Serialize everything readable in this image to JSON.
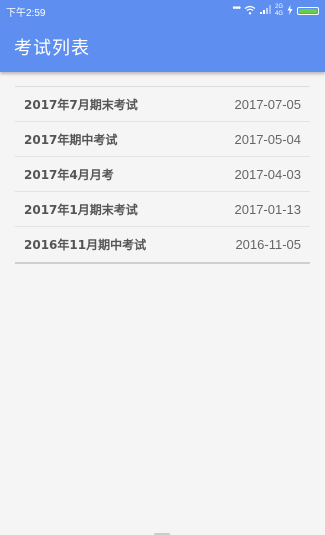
{
  "status_bar": {
    "time": "下午2:59",
    "dots": "•••",
    "network_label_top": "2G",
    "network_label_bottom": "4G",
    "battery_level": 1.0
  },
  "app_bar": {
    "title": "考试列表",
    "background_color": "#5e8ff0"
  },
  "exams": [
    {
      "name": "2017年7月期末考试",
      "date": "2017-07-05"
    },
    {
      "name": "2017年期中考试",
      "date": "2017-05-04"
    },
    {
      "name": "2017年4月月考",
      "date": "2017-04-03"
    },
    {
      "name": "2017年1月期末考试",
      "date": "2017-01-13"
    },
    {
      "name": "2016年11月期中考试",
      "date": "2016-11-05"
    }
  ]
}
